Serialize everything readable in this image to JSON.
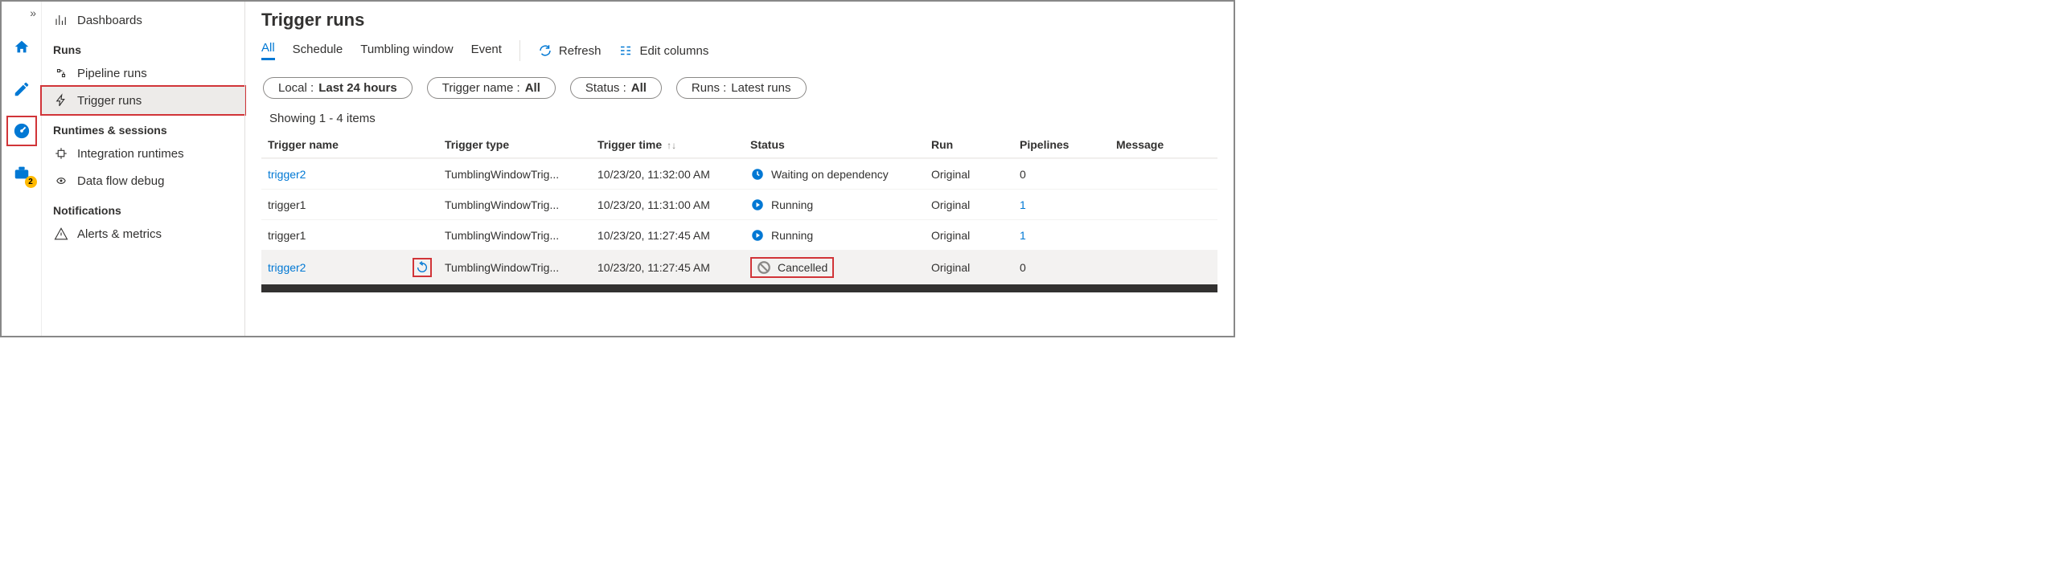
{
  "rail": {
    "collapse": "»",
    "badgeCount": "2"
  },
  "sidebar": {
    "dashboards": "Dashboards",
    "sections": {
      "runs": "Runs",
      "runtimes": "Runtimes & sessions",
      "notifications": "Notifications"
    },
    "pipeline": "Pipeline runs",
    "trigger": "Trigger runs",
    "integration": "Integration runtimes",
    "dataflow": "Data flow debug",
    "alerts": "Alerts & metrics"
  },
  "page": {
    "title": "Trigger runs",
    "tabs": {
      "all": "All",
      "schedule": "Schedule",
      "tumbling": "Tumbling window",
      "event": "Event"
    },
    "refresh": "Refresh",
    "editcols": "Edit columns"
  },
  "filters": {
    "local_label": "Local :",
    "local_value": "Last 24 hours",
    "tname_label": "Trigger name :",
    "tname_value": "All",
    "status_label": "Status :",
    "status_value": "All",
    "runs_label": "Runs :",
    "runs_value": "Latest runs"
  },
  "showing": "Showing 1 - 4 items",
  "columns": {
    "name": "Trigger name",
    "type": "Trigger type",
    "time": "Trigger time",
    "status": "Status",
    "run": "Run",
    "pipelines": "Pipelines",
    "message": "Message"
  },
  "rows": [
    {
      "name": "trigger2",
      "nameLink": true,
      "type": "TumblingWindowTrig...",
      "time": "10/23/20, 11:32:00 AM",
      "status": "Waiting on dependency",
      "statusKind": "waiting",
      "run": "Original",
      "pipes": "0",
      "pipesLink": false,
      "rerun": false,
      "hover": false
    },
    {
      "name": "trigger1",
      "nameLink": false,
      "type": "TumblingWindowTrig...",
      "time": "10/23/20, 11:31:00 AM",
      "status": "Running",
      "statusKind": "running",
      "run": "Original",
      "pipes": "1",
      "pipesLink": true,
      "rerun": false,
      "hover": false
    },
    {
      "name": "trigger1",
      "nameLink": false,
      "type": "TumblingWindowTrig...",
      "time": "10/23/20, 11:27:45 AM",
      "status": "Running",
      "statusKind": "running",
      "run": "Original",
      "pipes": "1",
      "pipesLink": true,
      "rerun": false,
      "hover": false
    },
    {
      "name": "trigger2",
      "nameLink": true,
      "type": "TumblingWindowTrig...",
      "time": "10/23/20, 11:27:45 AM",
      "status": "Cancelled",
      "statusKind": "cancelled",
      "run": "Original",
      "pipes": "0",
      "pipesLink": false,
      "rerun": true,
      "hover": true
    }
  ]
}
